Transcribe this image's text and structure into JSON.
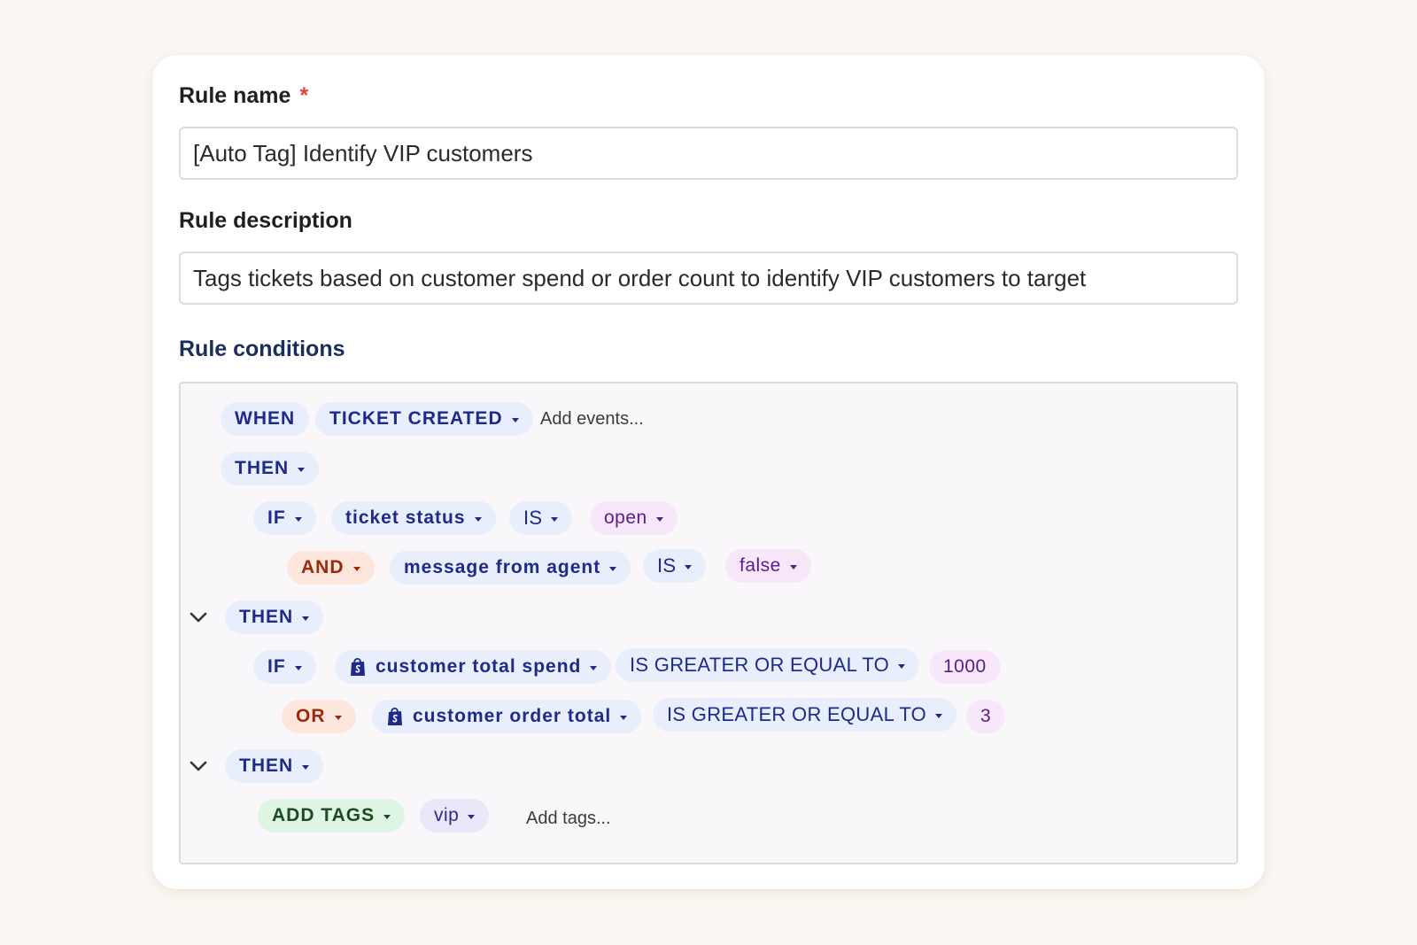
{
  "form": {
    "rule_name_label": "Rule name",
    "required_mark": "*",
    "rule_name_value": "[Auto Tag] Identify VIP customers",
    "rule_description_label": "Rule description",
    "rule_description_value": "Tags tickets based on customer spend or order count to identify VIP customers to target",
    "rule_conditions_label": "Rule conditions"
  },
  "conditions": {
    "when_label": "WHEN",
    "event": "TICKET CREATED",
    "add_events": "Add events...",
    "then_1": "THEN",
    "if_1": "IF",
    "if_1_field": "ticket status",
    "if_1_op": "IS",
    "if_1_value": "open",
    "and_1": "AND",
    "and_1_field": "message from agent",
    "and_1_op": "IS",
    "and_1_value": "false",
    "then_2": "THEN",
    "if_2": "IF",
    "if_2_field": "customer total spend",
    "if_2_op": "IS GREATER OR EQUAL TO",
    "if_2_value": "1000",
    "or_1": "OR",
    "or_1_field": "customer order total",
    "or_1_op": "IS GREATER OR EQUAL TO",
    "or_1_value": "3",
    "then_3": "THEN",
    "action": "ADD TAGS",
    "tag": "vip",
    "add_tags": "Add tags..."
  },
  "icons": {
    "shop": "shopify-bag-icon",
    "chevron": "chevron-down-icon",
    "caret": "caret-down-icon"
  },
  "colors": {
    "page_bg": "#fcf7f2",
    "card_bg": "#ffffff",
    "accent_navy": "#1a2e5c",
    "required_red": "#e0433a",
    "pill_blue": "#e8eefb",
    "pill_purple": "#f8e6fb",
    "pill_orange": "#fde7dd",
    "pill_green": "#def5e4"
  }
}
